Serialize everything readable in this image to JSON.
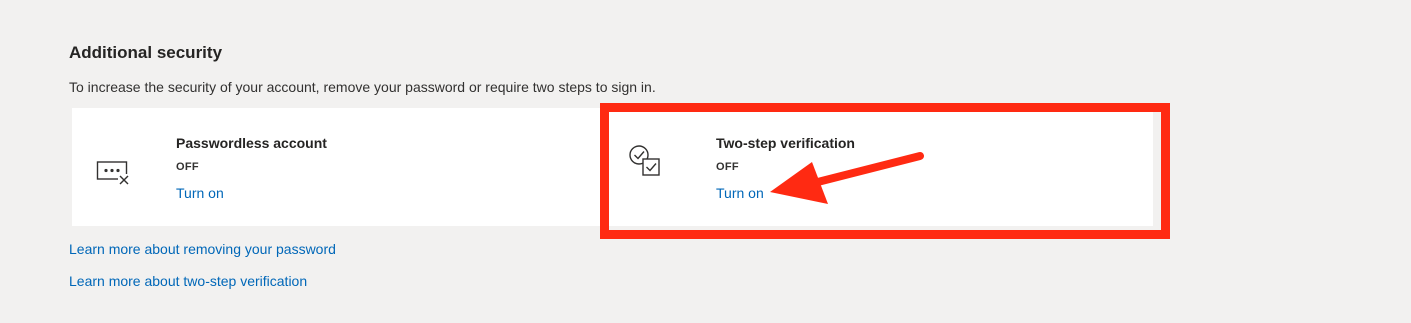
{
  "section": {
    "title": "Additional security",
    "description": "To increase the security of your account, remove your password or require two steps to sign in."
  },
  "cards": {
    "passwordless": {
      "icon": "password-dots-x-icon",
      "title": "Passwordless account",
      "status": "OFF",
      "action": "Turn on"
    },
    "two_step": {
      "icon": "two-step-check-icon",
      "title": "Two-step verification",
      "status": "OFF",
      "action": "Turn on"
    }
  },
  "links": {
    "learn_passwordless": "Learn more about removing your password",
    "learn_two_step": "Learn more about two-step verification"
  },
  "annotation": {
    "highlight_color": "#ff2a12",
    "target": "two_step.action"
  },
  "colors": {
    "background": "#f2f1f0",
    "card": "#ffffff",
    "link": "#0067b8",
    "text": "#323130"
  }
}
